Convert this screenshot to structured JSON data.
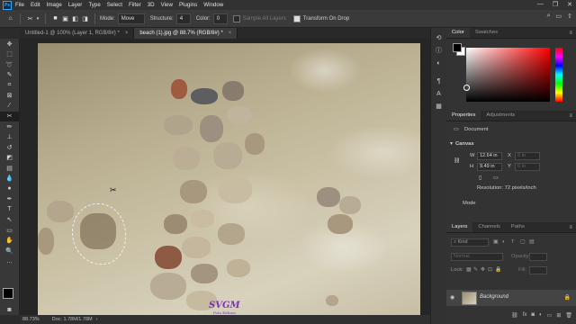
{
  "app": {
    "logo": "Ps"
  },
  "menu": [
    "File",
    "Edit",
    "Image",
    "Layer",
    "Type",
    "Select",
    "Filter",
    "3D",
    "View",
    "Plugins",
    "Window"
  ],
  "window_controls": [
    "—",
    "❐",
    "✕"
  ],
  "options": {
    "mode_label": "Mode:",
    "mode_value": "Move",
    "structure_label": "Structure:",
    "structure_value": "4",
    "color_label": "Color:",
    "color_value": "0",
    "sample_all_layers": "Sample All Layers",
    "transform_on_drop": "Transform On Drop"
  },
  "tabs": [
    {
      "label": "Untitled-1 @ 100% (Layer 1, RGB/8#) *",
      "active": false
    },
    {
      "label": "beach (1).jpg @ 88.7% (RGB/8#) *",
      "active": true
    }
  ],
  "status": {
    "zoom": "88.73%",
    "doc": "Doc: 1.78M/1.78M"
  },
  "color_panel": {
    "tabs": [
      "Color",
      "Swatches"
    ],
    "hue_color": "#ff0000"
  },
  "properties_panel": {
    "tabs": [
      "Properties",
      "Adjustments"
    ],
    "document_label": "Document",
    "canvas_label": "Canvas",
    "w_label": "W",
    "w_value": "12.64 in",
    "h_label": "H",
    "h_value": "9.49 in",
    "x_label": "X",
    "x_value": "0 in",
    "y_label": "Y",
    "y_value": "0 in",
    "resolution": "Resolution: 72 pixels/inch",
    "mode_label": "Mode"
  },
  "layers_panel": {
    "tabs": [
      "Layers",
      "Channels",
      "Paths"
    ],
    "kind_placeholder": "Kind",
    "blend_mode": "Normal",
    "opacity_label": "Opacity:",
    "lock_label": "Lock:",
    "fill_label": "Fill:",
    "layer_name": "Background"
  },
  "watermark": {
    "text": "SVGM",
    "sub": "Foto Edition"
  }
}
